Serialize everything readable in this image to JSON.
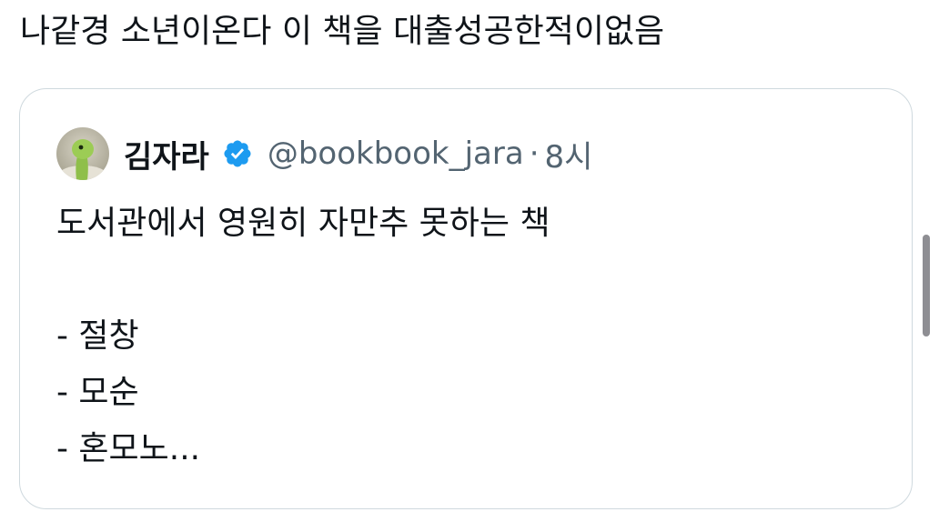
{
  "tweet": {
    "text": "나같경 소년이온다 이 책을 대출성공한적이없음"
  },
  "quoted_tweet": {
    "author_name": "김자라",
    "verified_icon": "verified-badge-icon",
    "handle": "@bookbook_jara",
    "separator": "·",
    "time": "8시",
    "lines": [
      "도서관에서 영원히 자만추 못하는 책",
      "",
      "- 절창",
      "- 모순",
      "- 혼모노..."
    ]
  },
  "colors": {
    "text_primary": "#0f1419",
    "text_secondary": "#536471",
    "card_border": "#cfd9de",
    "verified_blue": "#1d9bf0",
    "scrollbar": "#8e8e93"
  }
}
